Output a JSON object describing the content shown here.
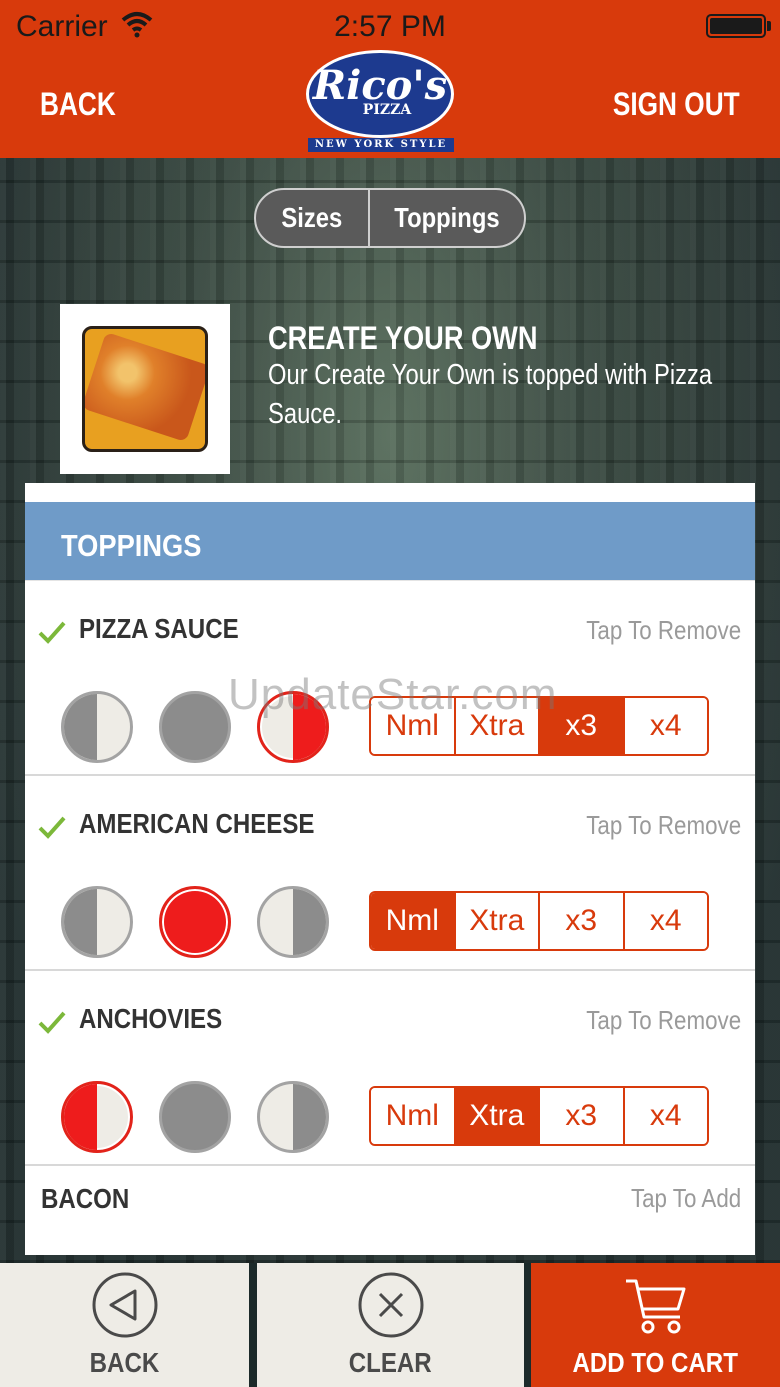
{
  "status_bar": {
    "carrier": "Carrier",
    "time": "2:57 PM"
  },
  "nav": {
    "back_label": "BACK",
    "signout_label": "SIGN OUT"
  },
  "logo": {
    "script": "Rico's",
    "pizza": "PIZZA",
    "tagline": "NEW YORK STYLE"
  },
  "segments": {
    "sizes": "Sizes",
    "toppings": "Toppings",
    "selected": "Toppings"
  },
  "product": {
    "title": "CREATE YOUR OWN",
    "description": "Our Create Your Own is topped with Pizza Sauce."
  },
  "panel": {
    "header": "TOPPINGS"
  },
  "toppings": [
    {
      "name": "PIZZA SAUCE",
      "action": "Tap To Remove",
      "checked": true,
      "coverage": "right",
      "quantity": "x3",
      "qty_labels": [
        "Nml",
        "Xtra",
        "x3",
        "x4"
      ]
    },
    {
      "name": "AMERICAN CHEESE",
      "action": "Tap To Remove",
      "checked": true,
      "coverage": "whole",
      "quantity": "Nml",
      "qty_labels": [
        "Nml",
        "Xtra",
        "x3",
        "x4"
      ]
    },
    {
      "name": "ANCHOVIES",
      "action": "Tap To Remove",
      "checked": true,
      "coverage": "left",
      "quantity": "Xtra",
      "qty_labels": [
        "Nml",
        "Xtra",
        "x3",
        "x4"
      ]
    }
  ],
  "bacon": {
    "name": "BACON",
    "action": "Tap To Add"
  },
  "watermark": "UpdateStar.com",
  "tabbar": {
    "back": "BACK",
    "clear": "CLEAR",
    "cart": "ADD TO CART"
  },
  "colors": {
    "brand": "#d83a0c",
    "header_blue": "#6f9bc8",
    "selected_red": "#ee1c1c",
    "check_green": "#7cb83a"
  },
  "icons": [
    "wifi-icon",
    "battery-icon",
    "check-icon",
    "back-arrow-icon",
    "close-icon",
    "cart-icon"
  ]
}
